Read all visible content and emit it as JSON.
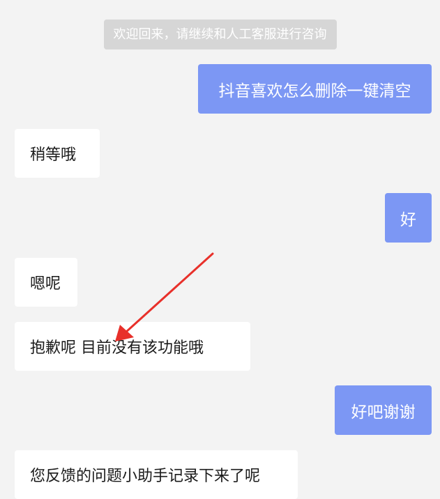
{
  "system_notice": "欢迎回来，请继续和人工客服进行咨询",
  "messages": [
    {
      "sender": "user",
      "text": "抖音喜欢怎么删除一键清空"
    },
    {
      "sender": "agent",
      "text": "稍等哦"
    },
    {
      "sender": "user",
      "text": "好"
    },
    {
      "sender": "agent",
      "text": "嗯呢"
    },
    {
      "sender": "agent",
      "text": "抱歉呢 目前没有该功能哦"
    },
    {
      "sender": "user",
      "text": "好吧谢谢"
    },
    {
      "sender": "agent",
      "text": "您反馈的问题小助手记录下来了呢"
    }
  ],
  "colors": {
    "background": "#f3f3f3",
    "user_bubble": "#7c97f4",
    "agent_bubble": "#ffffff",
    "notice_bg": "#d6d6d6",
    "annotation_arrow": "#e8302a"
  }
}
